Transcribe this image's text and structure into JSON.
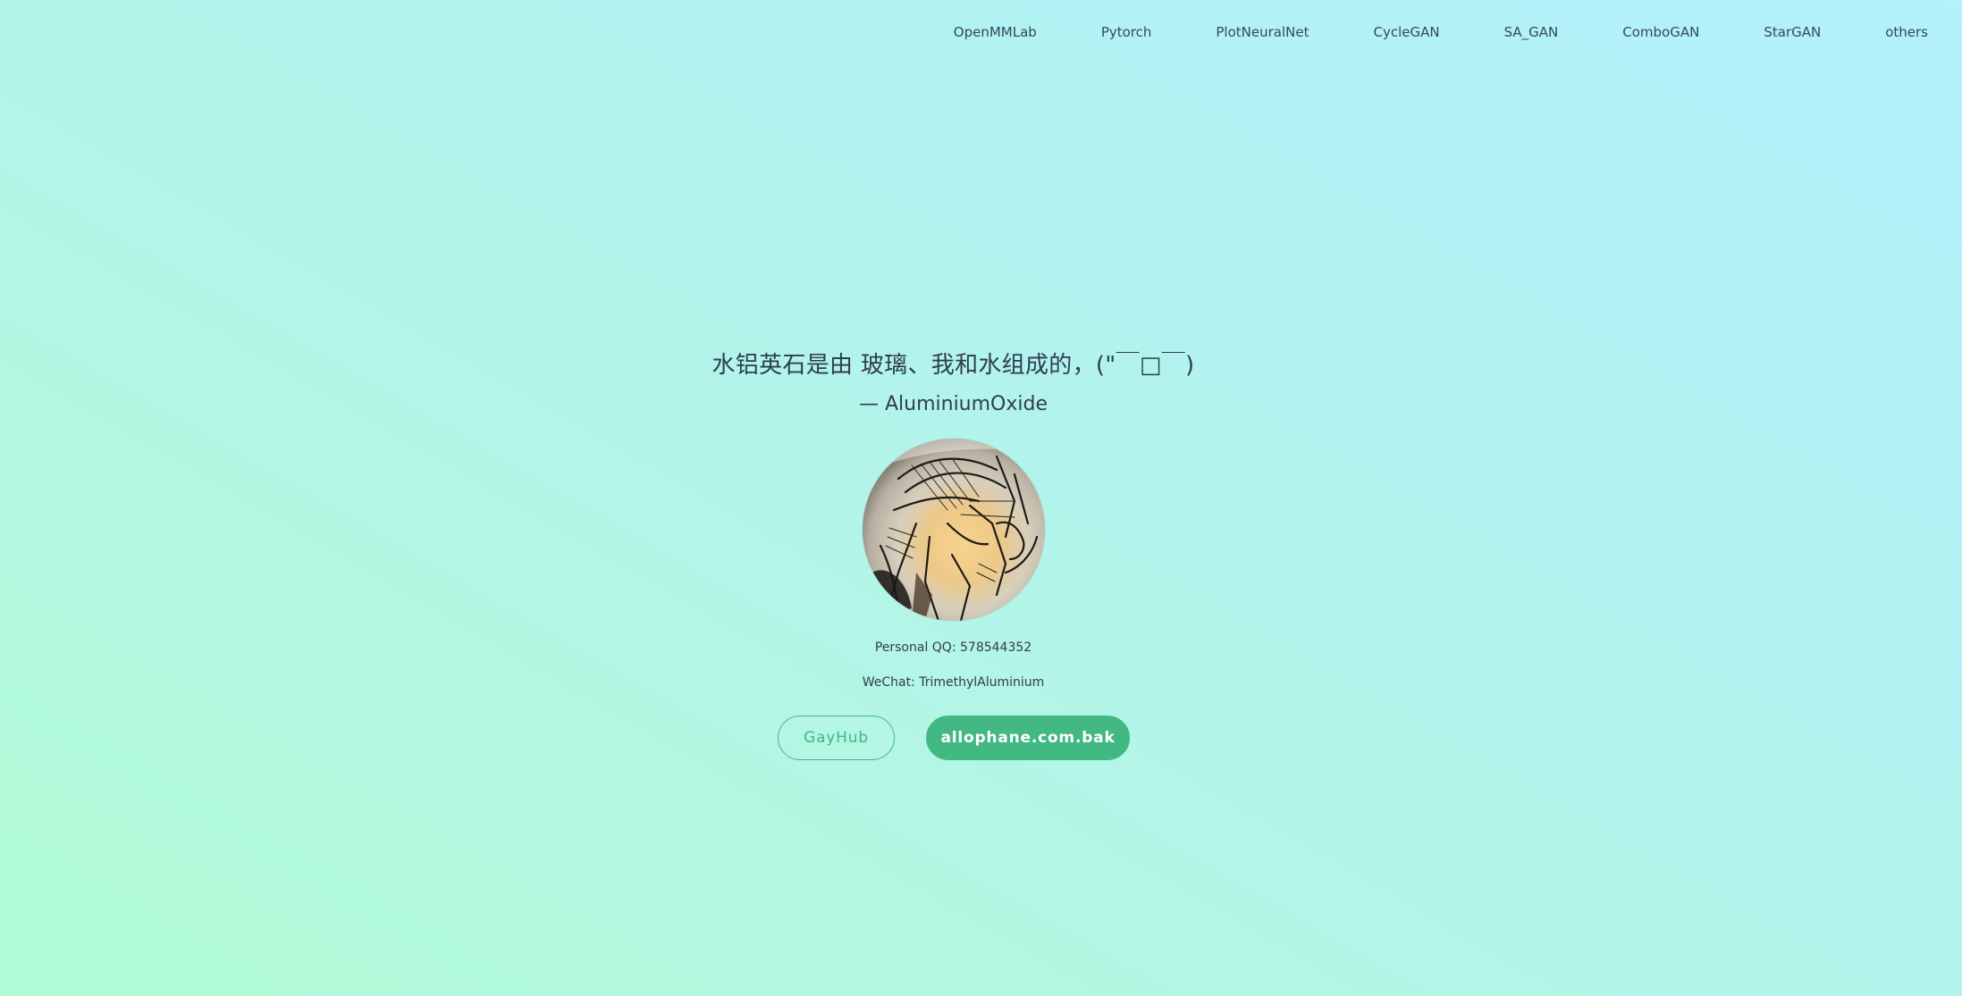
{
  "nav": {
    "items": [
      {
        "label": "OpenMMLab"
      },
      {
        "label": "Pytorch"
      },
      {
        "label": "PlotNeuralNet"
      },
      {
        "label": "CycleGAN"
      },
      {
        "label": "SA_GAN"
      },
      {
        "label": "ComboGAN"
      },
      {
        "label": "StarGAN"
      },
      {
        "label": "others"
      }
    ]
  },
  "hero": {
    "quote": "水铝英石是由 玻璃、我和水组成的，(\"￣□￣)",
    "author": "— AluminiumOxide",
    "contact_qq": "Personal QQ: 578544352",
    "contact_wechat": "WeChat: TrimethylAluminium",
    "button_outline_label": "GayHub",
    "button_solid_label": "allophane.com.bak"
  },
  "colors": {
    "accent": "#42b983",
    "text": "#2f3d4e"
  }
}
